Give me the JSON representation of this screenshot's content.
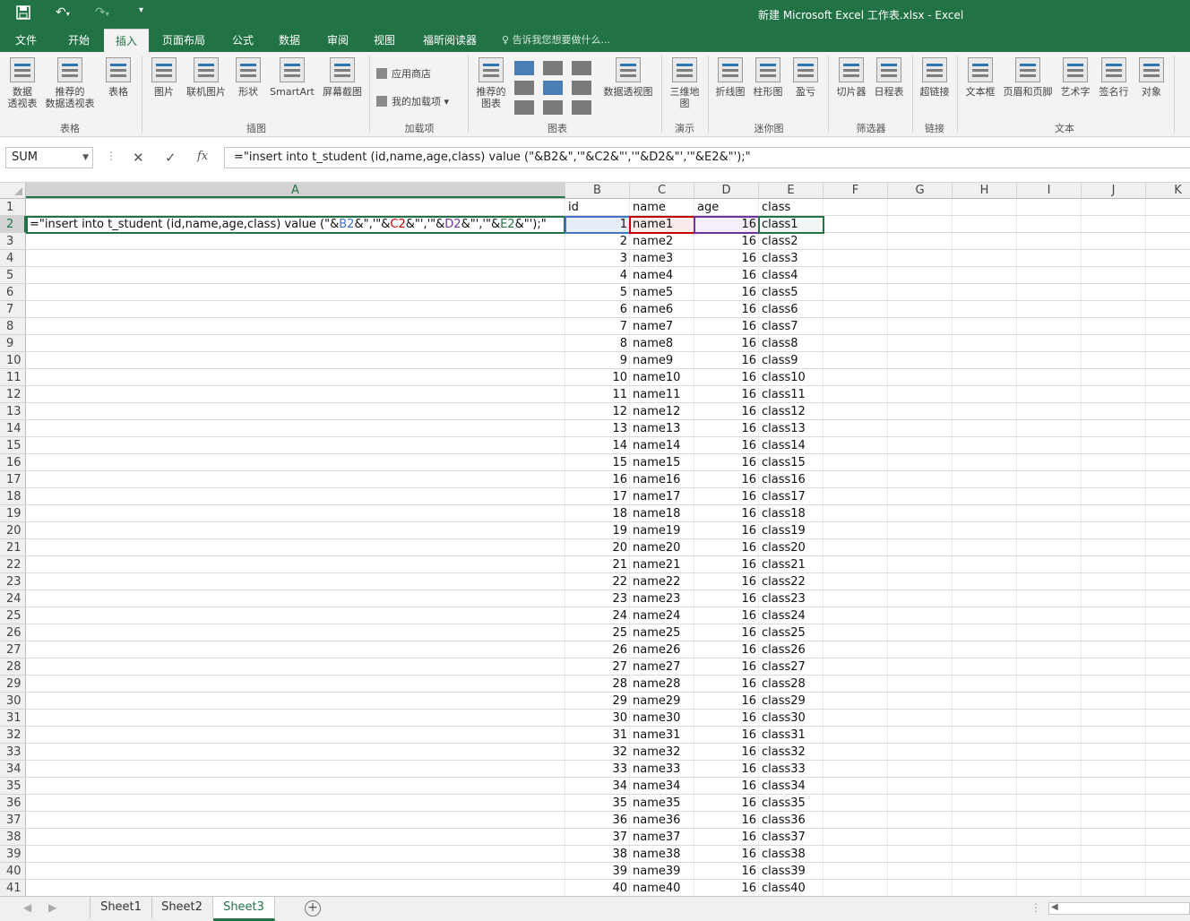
{
  "window": {
    "title": "新建 Microsoft Excel 工作表.xlsx - Excel"
  },
  "quick_access": [
    "save-icon",
    "undo-icon",
    "redo-icon",
    "customize-icon"
  ],
  "tabs": [
    "文件",
    "开始",
    "插入",
    "页面布局",
    "公式",
    "数据",
    "审阅",
    "视图",
    "福昕阅读器"
  ],
  "active_tab": "插入",
  "tell_me": "告诉我您想要做什么...",
  "ribbon": {
    "table_group": {
      "label": "表格",
      "pivot1": "数据",
      "pivot2": "透视表",
      "rec1": "推荐的",
      "rec2": "数据透视表",
      "table": "表格"
    },
    "illustrations": {
      "label": "插图",
      "pictures": "图片",
      "online": "联机图片",
      "shapes": "形状",
      "smartart": "SmartArt",
      "screenshot": "屏幕截图"
    },
    "addins": {
      "label": "加载项",
      "store": "应用商店",
      "my": "我的加载项"
    },
    "charts": {
      "label": "图表",
      "rec1": "推荐的",
      "rec2": "图表",
      "pivotchart": "数据透视图"
    },
    "tours": {
      "label": "演示",
      "map1": "三维地",
      "map2": "图"
    },
    "sparklines": {
      "label": "迷你图",
      "line": "折线图",
      "column": "柱形图",
      "winloss": "盈亏"
    },
    "filters": {
      "label": "筛选器",
      "slicer": "切片器",
      "timeline": "日程表"
    },
    "links": {
      "label": "链接",
      "hyperlink": "超链接"
    },
    "text": {
      "label": "文本",
      "textbox": "文本框",
      "header": "页眉和页脚",
      "wordart": "艺术字",
      "signature": "签名行",
      "object": "对象"
    }
  },
  "formula_bar": {
    "name_box": "SUM",
    "cancel": "✕",
    "enter": "✓",
    "fx": "fx",
    "formula": "=\"insert into t_student (id,name,age,class) value (\"&B2&\",'\"&C2&\"','\"&D2&\"','\"&E2&\"');\""
  },
  "columns": [
    "A",
    "B",
    "C",
    "D",
    "E",
    "F",
    "G",
    "H",
    "I",
    "J",
    "K"
  ],
  "selected_column": "A",
  "selected_row": 2,
  "rows": [
    1,
    2,
    3,
    4,
    5,
    6,
    7,
    8,
    9,
    10,
    11,
    12,
    13,
    14,
    15,
    16,
    17,
    18,
    19,
    20,
    21,
    22,
    23,
    24,
    25,
    26,
    27,
    28,
    29,
    30,
    31,
    32,
    33,
    34,
    35,
    36,
    37,
    38,
    39,
    40,
    41
  ],
  "header_row": {
    "B": "id",
    "C": "name",
    "D": "age",
    "E": "class"
  },
  "editing_cell": {
    "address": "A2",
    "parts": [
      {
        "t": "=\"insert into t_student (id,name,age,class) value (\"&"
      },
      {
        "t": "B2",
        "ref": "B"
      },
      {
        "t": "&\",'\"&"
      },
      {
        "t": "C2",
        "ref": "C"
      },
      {
        "t": "&\"','\"&"
      },
      {
        "t": "D2",
        "ref": "D"
      },
      {
        "t": "&\"','\"&"
      },
      {
        "t": "E2",
        "ref": "E"
      },
      {
        "t": "&\"');\""
      }
    ]
  },
  "data_rows": [
    {
      "id": 1,
      "name": "name1",
      "age": 16,
      "class": "class1"
    },
    {
      "id": 2,
      "name": "name2",
      "age": 16,
      "class": "class2"
    },
    {
      "id": 3,
      "name": "name3",
      "age": 16,
      "class": "class3"
    },
    {
      "id": 4,
      "name": "name4",
      "age": 16,
      "class": "class4"
    },
    {
      "id": 5,
      "name": "name5",
      "age": 16,
      "class": "class5"
    },
    {
      "id": 6,
      "name": "name6",
      "age": 16,
      "class": "class6"
    },
    {
      "id": 7,
      "name": "name7",
      "age": 16,
      "class": "class7"
    },
    {
      "id": 8,
      "name": "name8",
      "age": 16,
      "class": "class8"
    },
    {
      "id": 9,
      "name": "name9",
      "age": 16,
      "class": "class9"
    },
    {
      "id": 10,
      "name": "name10",
      "age": 16,
      "class": "class10"
    },
    {
      "id": 11,
      "name": "name11",
      "age": 16,
      "class": "class11"
    },
    {
      "id": 12,
      "name": "name12",
      "age": 16,
      "class": "class12"
    },
    {
      "id": 13,
      "name": "name13",
      "age": 16,
      "class": "class13"
    },
    {
      "id": 14,
      "name": "name14",
      "age": 16,
      "class": "class14"
    },
    {
      "id": 15,
      "name": "name15",
      "age": 16,
      "class": "class15"
    },
    {
      "id": 16,
      "name": "name16",
      "age": 16,
      "class": "class16"
    },
    {
      "id": 17,
      "name": "name17",
      "age": 16,
      "class": "class17"
    },
    {
      "id": 18,
      "name": "name18",
      "age": 16,
      "class": "class18"
    },
    {
      "id": 19,
      "name": "name19",
      "age": 16,
      "class": "class19"
    },
    {
      "id": 20,
      "name": "name20",
      "age": 16,
      "class": "class20"
    },
    {
      "id": 21,
      "name": "name21",
      "age": 16,
      "class": "class21"
    },
    {
      "id": 22,
      "name": "name22",
      "age": 16,
      "class": "class22"
    },
    {
      "id": 23,
      "name": "name23",
      "age": 16,
      "class": "class23"
    },
    {
      "id": 24,
      "name": "name24",
      "age": 16,
      "class": "class24"
    },
    {
      "id": 25,
      "name": "name25",
      "age": 16,
      "class": "class25"
    },
    {
      "id": 26,
      "name": "name26",
      "age": 16,
      "class": "class26"
    },
    {
      "id": 27,
      "name": "name27",
      "age": 16,
      "class": "class27"
    },
    {
      "id": 28,
      "name": "name28",
      "age": 16,
      "class": "class28"
    },
    {
      "id": 29,
      "name": "name29",
      "age": 16,
      "class": "class29"
    },
    {
      "id": 30,
      "name": "name30",
      "age": 16,
      "class": "class30"
    },
    {
      "id": 31,
      "name": "name31",
      "age": 16,
      "class": "class31"
    },
    {
      "id": 32,
      "name": "name32",
      "age": 16,
      "class": "class32"
    },
    {
      "id": 33,
      "name": "name33",
      "age": 16,
      "class": "class33"
    },
    {
      "id": 34,
      "name": "name34",
      "age": 16,
      "class": "class34"
    },
    {
      "id": 35,
      "name": "name35",
      "age": 16,
      "class": "class35"
    },
    {
      "id": 36,
      "name": "name36",
      "age": 16,
      "class": "class36"
    },
    {
      "id": 37,
      "name": "name37",
      "age": 16,
      "class": "class37"
    },
    {
      "id": 38,
      "name": "name38",
      "age": 16,
      "class": "class38"
    },
    {
      "id": 39,
      "name": "name39",
      "age": 16,
      "class": "class39"
    },
    {
      "id": 40,
      "name": "name40",
      "age": 16,
      "class": "class40"
    }
  ],
  "ref_colors": {
    "B": "#4472c4",
    "C": "#c00000",
    "D": "#7030a0",
    "E": "#217346"
  },
  "sheets": [
    "Sheet1",
    "Sheet2",
    "Sheet3"
  ],
  "active_sheet": "Sheet3",
  "colors": {
    "accent": "#217346"
  }
}
